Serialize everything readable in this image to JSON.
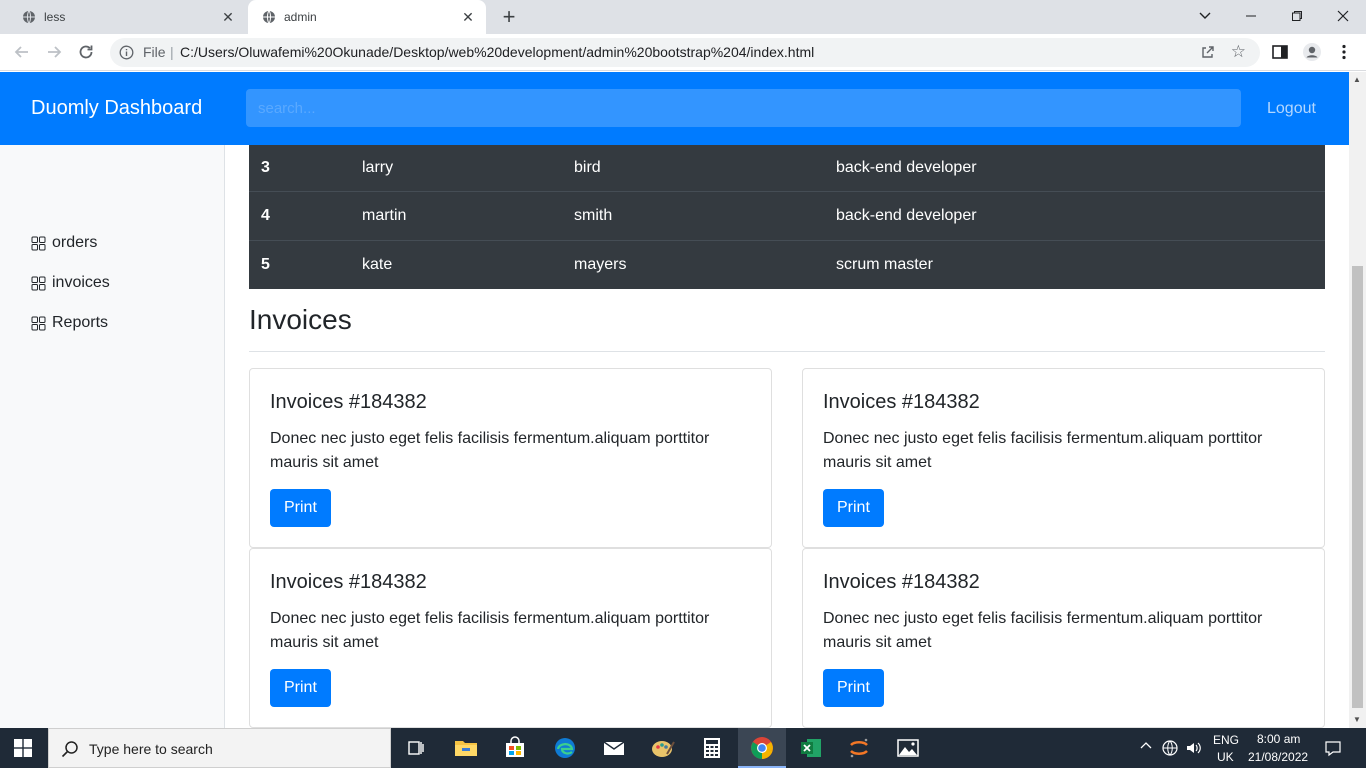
{
  "browser": {
    "tabs": [
      {
        "title": "less",
        "active": false
      },
      {
        "title": "admin",
        "active": true
      }
    ],
    "address": {
      "scheme_label": "File",
      "url": "C:/Users/Oluwafemi%20Okunade/Desktop/web%20development/admin%20bootstrap%204/index.html"
    }
  },
  "app": {
    "brand": "Duomly Dashboard",
    "search_placeholder": "search...",
    "logout": "Logout",
    "accent_color": "#007bff"
  },
  "sidebar": {
    "items": [
      {
        "label": "orders",
        "icon": "grid-icon"
      },
      {
        "label": "invoices",
        "icon": "grid-icon"
      },
      {
        "label": "Reports",
        "icon": "grid-icon"
      }
    ]
  },
  "users_table": {
    "rows": [
      {
        "id": "3",
        "first": "larry",
        "last": "bird",
        "role": "back-end developer"
      },
      {
        "id": "4",
        "first": "martin",
        "last": "smith",
        "role": "back-end developer"
      },
      {
        "id": "5",
        "first": "kate",
        "last": "mayers",
        "role": "scrum master"
      }
    ]
  },
  "invoices": {
    "heading": "Invoices",
    "cards": [
      {
        "title": "Invoices #184382",
        "text": "Donec nec justo eget felis facilisis fermentum.aliquam porttitor mauris sit amet",
        "button": "Print"
      },
      {
        "title": "Invoices #184382",
        "text": "Donec nec justo eget felis facilisis fermentum.aliquam porttitor mauris sit amet",
        "button": "Print"
      },
      {
        "title": "Invoices #184382",
        "text": "Donec nec justo eget felis facilisis fermentum.aliquam porttitor mauris sit amet",
        "button": "Print"
      },
      {
        "title": "Invoices #184382",
        "text": "Donec nec justo eget felis facilisis fermentum.aliquam porttitor mauris sit amet",
        "button": "Print"
      }
    ]
  },
  "taskbar": {
    "search_placeholder": "Type here to search",
    "lang_top": "ENG",
    "lang_bottom": "UK",
    "time": "8:00 am",
    "date": "21/08/2022"
  }
}
